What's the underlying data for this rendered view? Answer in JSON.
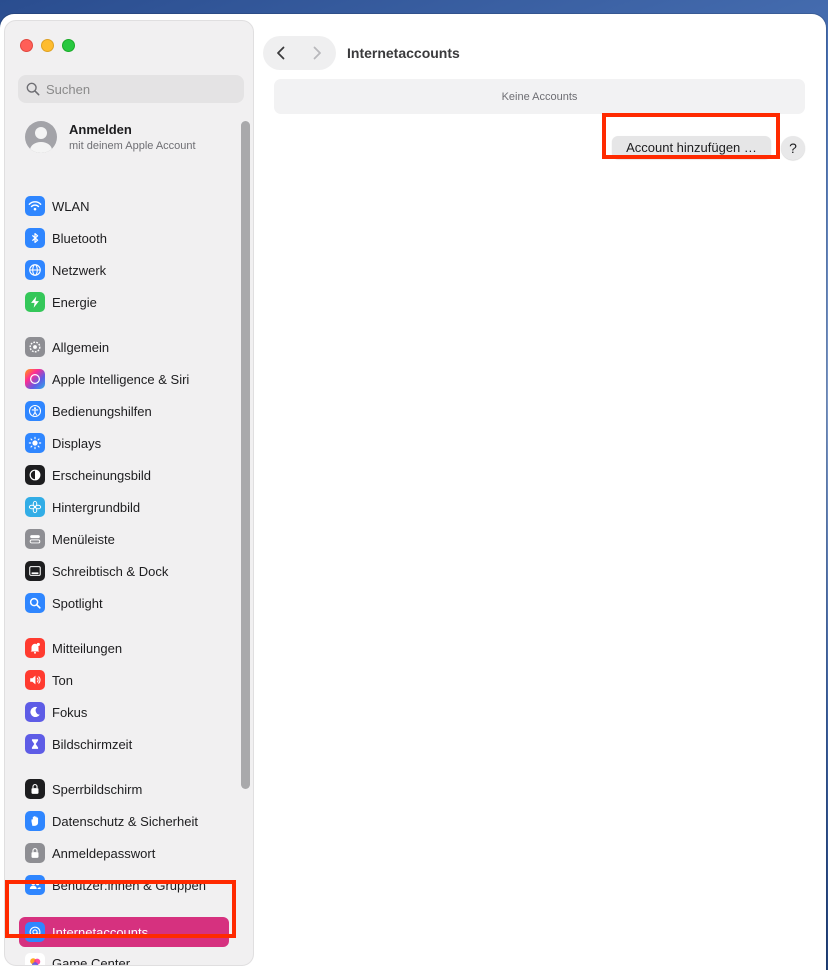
{
  "window": {
    "title": "Internetaccounts"
  },
  "search": {
    "placeholder": "Suchen"
  },
  "account": {
    "name": "Anmelden",
    "subtitle": "mit deinem Apple Account"
  },
  "sidebar": {
    "items": [
      {
        "label": "WLAN",
        "icon": "wifi-icon",
        "color": "#2f86ff"
      },
      {
        "label": "Bluetooth",
        "icon": "bluetooth-icon",
        "color": "#2f86ff"
      },
      {
        "label": "Netzwerk",
        "icon": "globe-icon",
        "color": "#2f86ff"
      },
      {
        "label": "Energie",
        "icon": "bolt-icon",
        "color": "#34c759"
      },
      {
        "label": "Allgemein",
        "icon": "gear-icon",
        "color": "#8e8e93"
      },
      {
        "label": "Apple Intelligence & Siri",
        "icon": "siri-icon",
        "color": "#c24bd6"
      },
      {
        "label": "Bedienungshilfen",
        "icon": "accessibility-icon",
        "color": "#2f86ff"
      },
      {
        "label": "Displays",
        "icon": "sun-icon",
        "color": "#2f86ff"
      },
      {
        "label": "Erscheinungsbild",
        "icon": "appearance-icon",
        "color": "#1d1d1f"
      },
      {
        "label": "Hintergrundbild",
        "icon": "flower-icon",
        "color": "#32ade6"
      },
      {
        "label": "Menüleiste",
        "icon": "menubar-icon",
        "color": "#8e8e93"
      },
      {
        "label": "Schreibtisch & Dock",
        "icon": "dock-icon",
        "color": "#1d1d1f"
      },
      {
        "label": "Spotlight",
        "icon": "magnifier-icon",
        "color": "#2f86ff"
      },
      {
        "label": "Mitteilungen",
        "icon": "bell-icon",
        "color": "#ff3b30"
      },
      {
        "label": "Ton",
        "icon": "speaker-icon",
        "color": "#ff3b30"
      },
      {
        "label": "Fokus",
        "icon": "moon-icon",
        "color": "#5e5ce6"
      },
      {
        "label": "Bildschirmzeit",
        "icon": "hourglass-icon",
        "color": "#5e5ce6"
      },
      {
        "label": "Sperrbildschirm",
        "icon": "lockscreen-icon",
        "color": "#1d1d1f"
      },
      {
        "label": "Datenschutz & Sicherheit",
        "icon": "hand-icon",
        "color": "#2f86ff"
      },
      {
        "label": "Anmeldepasswort",
        "icon": "lock-icon",
        "color": "#8e8e93"
      },
      {
        "label": "Benutzer:innen & Gruppen",
        "icon": "users-icon",
        "color": "#2f86ff"
      },
      {
        "label": "Internetaccounts",
        "icon": "at-icon",
        "color": "#2f86ff",
        "selected": true
      },
      {
        "label": "Game Center",
        "icon": "gamecenter-icon",
        "color": "#ffffff"
      }
    ]
  },
  "main": {
    "empty_text": "Keine Accounts",
    "add_button": "Account hinzufügen …",
    "help_button": "?"
  },
  "colors": {
    "selection": "#d6317f",
    "highlight": "#ff2a00"
  }
}
